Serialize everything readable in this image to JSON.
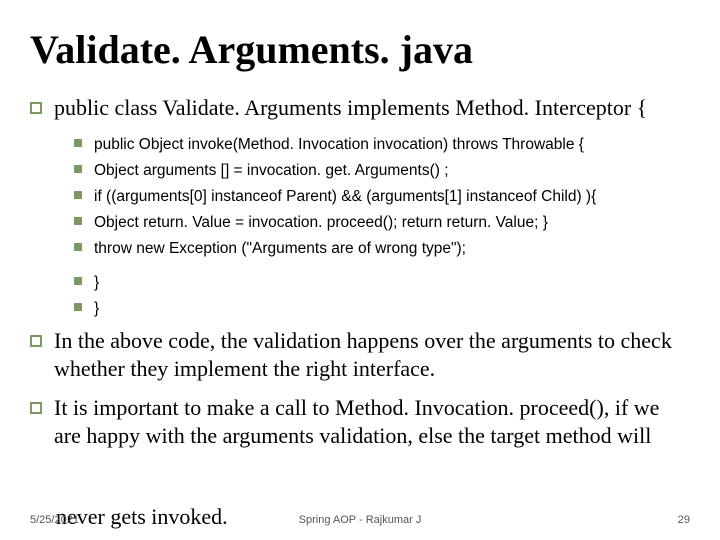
{
  "title": "Validate. Arguments. java",
  "bullets": {
    "b0": "public class Validate. Arguments implements Method. Interceptor {",
    "sub": {
      "s0": "public Object invoke(Method. Invocation invocation) throws Throwable {",
      "s1": " Object arguments [] = invocation. get. Arguments() ;",
      "s2": "if ((arguments[0] instanceof Parent) && (arguments[1] instanceof Child) ){",
      "s3": "Object return. Value = invocation. proceed(); return return. Value; }",
      "s4": " throw new Exception (\"Arguments are of wrong type\");",
      "s5": "}",
      "s6": "}"
    },
    "b1": "In the above code, the validation happens over the arguments to check whether they implement the right interface.",
    "b2": "It is important to make a call to Method. Invocation. proceed(), if we are happy with the arguments validation, else the target method will",
    "b2_tail": "never gets invoked."
  },
  "footer": {
    "left": "5/25/2021",
    "center": "Spring AOP  -  Rajkumar J",
    "right": "29"
  }
}
